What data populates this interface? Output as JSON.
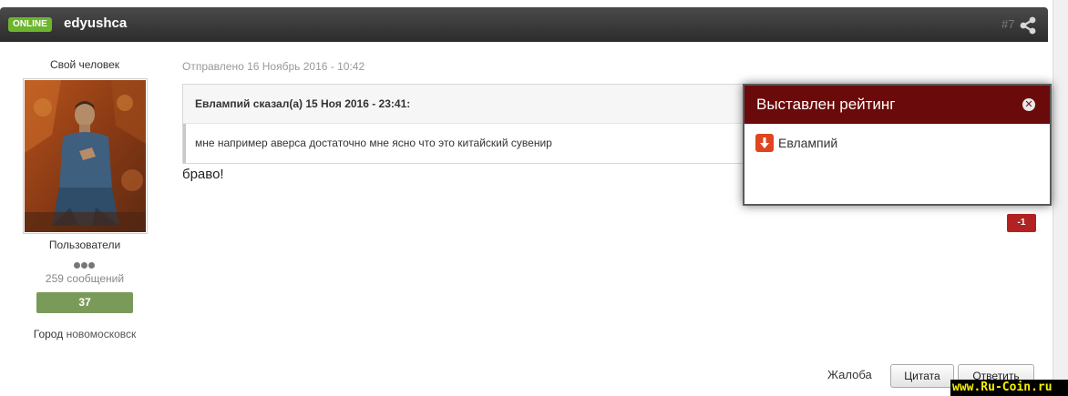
{
  "header": {
    "online_label": "ONLINE",
    "username": "edyushca",
    "post_number": "#7",
    "icons": [
      "share-icon"
    ]
  },
  "author": {
    "title": "Свой человек",
    "group": "Пользователи",
    "post_count": "259 сообщений",
    "reputation": "37",
    "city_label": "Город",
    "city_value": "новомосковск"
  },
  "post": {
    "date": "Отправлено 16 Ноябрь 2016 - 10:42",
    "quote_header": "Евлампий сказал(а) 15 Ноя 2016 - 23:41:",
    "quote_text": "мне например аверса достаточно мне ясно что это китайский сувенир",
    "body": "браво!",
    "rating": "-1"
  },
  "popup": {
    "title": "Выставлен рейтинг",
    "user": "Евлампий",
    "icons": [
      "close-icon",
      "arrow-down-icon"
    ]
  },
  "actions": {
    "complain": "Жалоба",
    "quote": "Цитата",
    "reply": "Ответить"
  },
  "watermark": "www.Ru-Coin.ru",
  "colors": {
    "header_bg": "#333333",
    "online_badge": "#6cb52d",
    "reputation_bg": "#7a9a5a",
    "popup_head": "#6b0a0a",
    "negative_rating": "#b22222"
  }
}
